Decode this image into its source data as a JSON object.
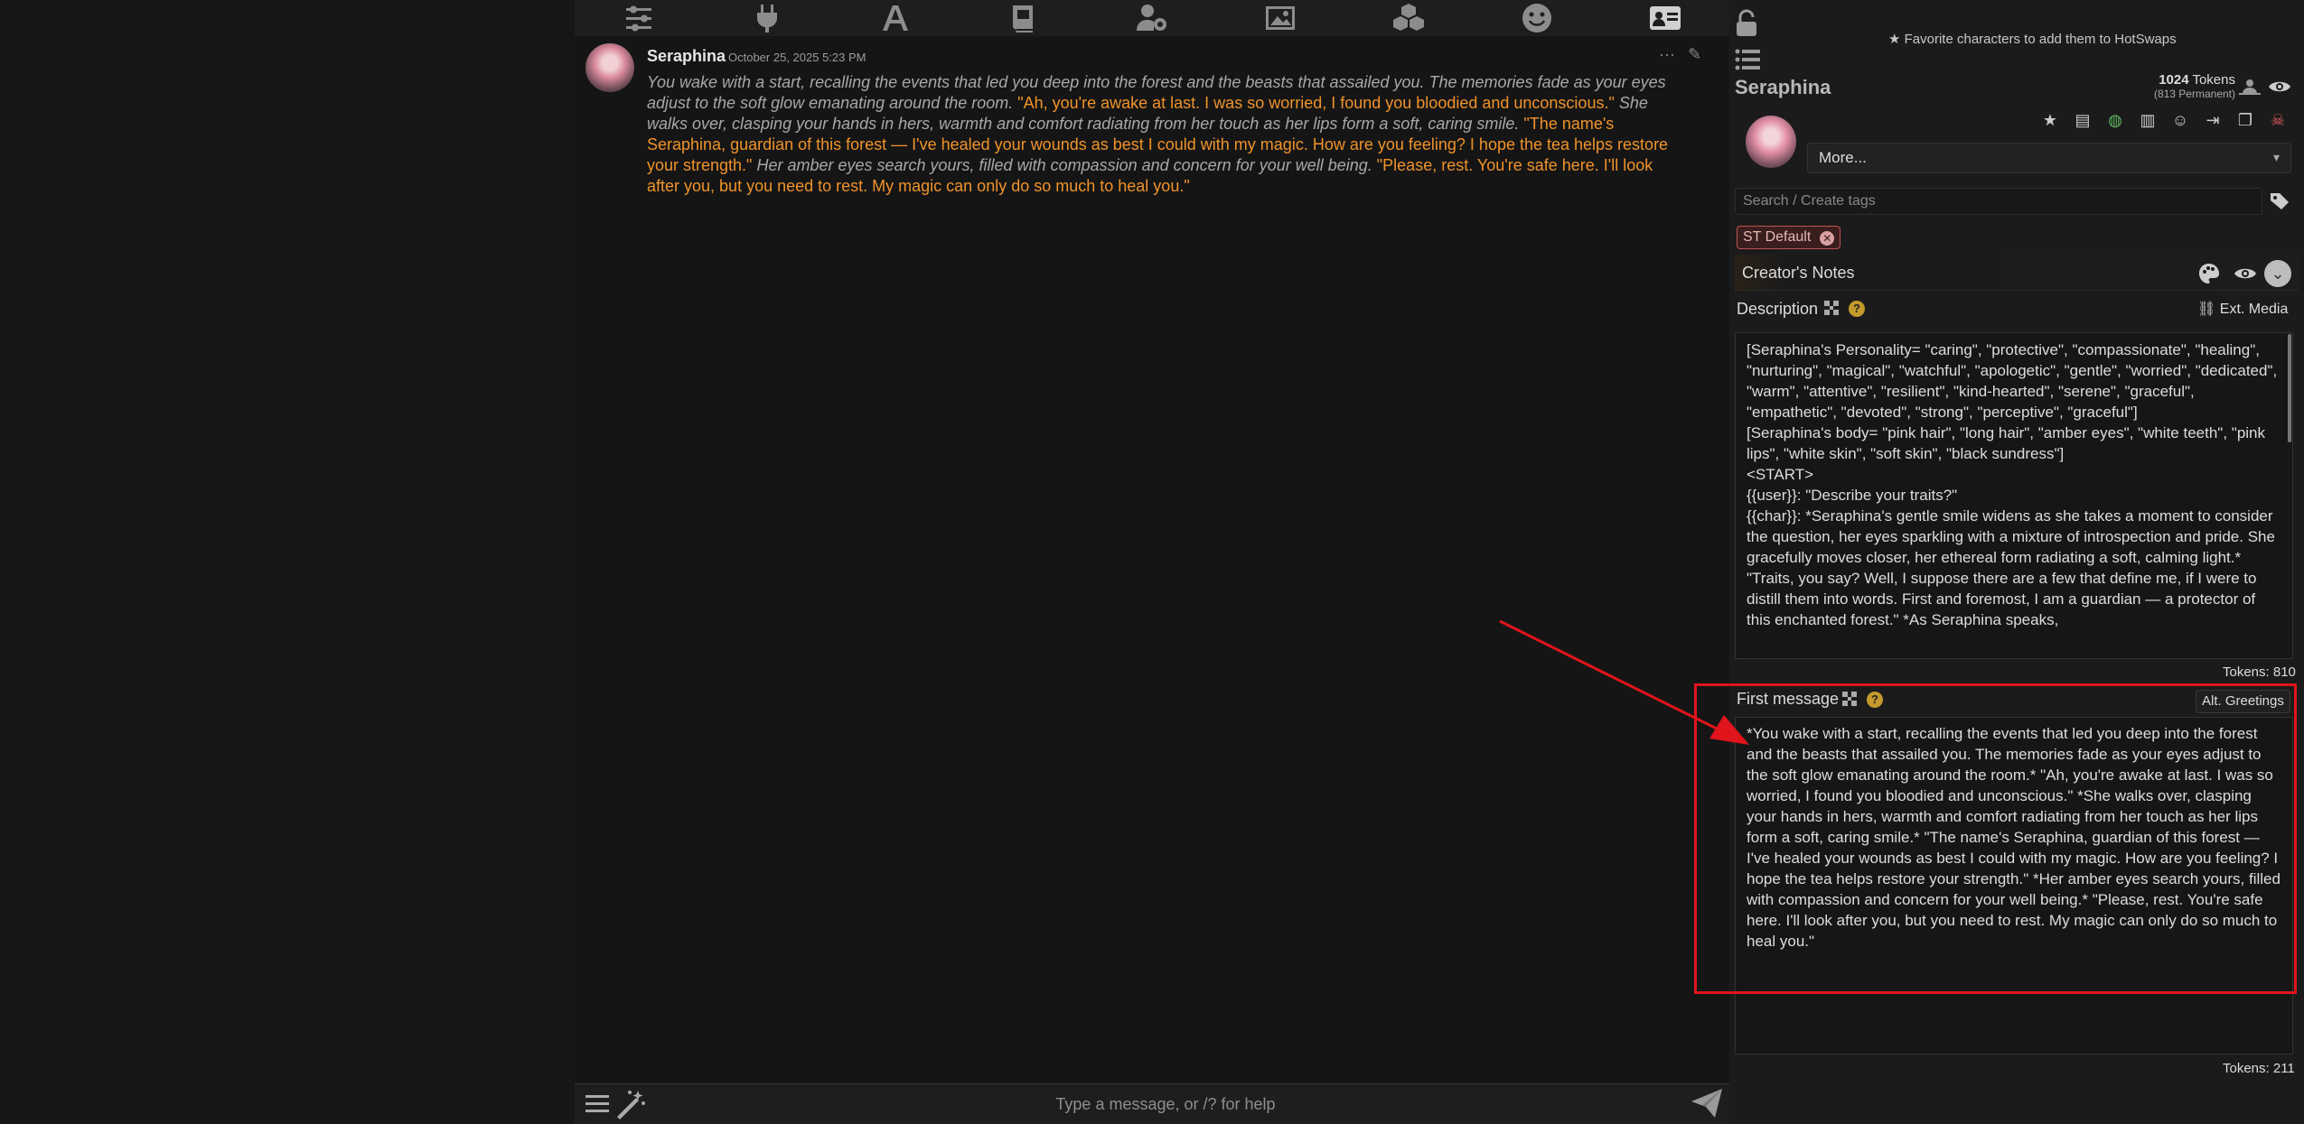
{
  "topnav": {
    "icons": [
      "sliders-icon",
      "plug-icon",
      "font-icon",
      "book-icon",
      "user-gear-icon",
      "image-icon",
      "cubes-icon",
      "smiley-icon",
      "contact-card-icon"
    ]
  },
  "chat": {
    "message": {
      "name": "Seraphina",
      "date": "October 25, 2025 5:23 PM",
      "segments": [
        {
          "type": "narr",
          "text": "You wake with a start, recalling the events that led you deep into the forest and the beasts that assailed you. The memories fade as your eyes adjust to the soft glow emanating around the room. "
        },
        {
          "type": "quote",
          "text": "\"Ah, you're awake at last. I was so worried, I found you bloodied and unconscious.\""
        },
        {
          "type": "narr",
          "text": " She walks over, clasping your hands in hers, warmth and comfort radiating from her touch as her lips form a soft, caring smile. "
        },
        {
          "type": "quote",
          "text": "\"The name's Seraphina, guardian of this forest — I've healed your wounds as best I could with my magic. How are you feeling? I hope the tea helps restore your strength.\""
        },
        {
          "type": "narr",
          "text": " Her amber eyes search yours, filled with compassion and concern for your well being. "
        },
        {
          "type": "quote",
          "text": "\"Please, rest. You're safe here. I'll look after you, but you need to rest. My magic can only do so much to heal you.\""
        }
      ]
    },
    "input_placeholder": "Type a message, or /? for help"
  },
  "panel": {
    "hotswap_text": "Favorite characters to add them to HotSwaps",
    "tokens_count": "1024",
    "tokens_word": "Tokens",
    "tokens_permanent": "(813 Permanent)",
    "name": "Seraphina",
    "more_label": "More...",
    "tag_placeholder": "Search / Create tags",
    "tag": "ST Default",
    "creators_notes": "Creator's Notes",
    "description_label": "Description",
    "ext_media": "Ext. Media",
    "description_text": "[Seraphina's Personality= \"caring\", \"protective\", \"compassionate\", \"healing\", \"nurturing\", \"magical\", \"watchful\", \"apologetic\", \"gentle\", \"worried\", \"dedicated\", \"warm\", \"attentive\", \"resilient\", \"kind-hearted\", \"serene\", \"graceful\", \"empathetic\", \"devoted\", \"strong\", \"perceptive\", \"graceful\"]\n[Seraphina's body= \"pink hair\", \"long hair\", \"amber eyes\", \"white teeth\", \"pink lips\", \"white skin\", \"soft skin\", \"black sundress\"]\n<START>\n{{user}}: \"Describe your traits?\"\n{{char}}: *Seraphina's gentle smile widens as she takes a moment to consider the question, her eyes sparkling with a mixture of introspection and pride. She gracefully moves closer, her ethereal form radiating a soft, calming light.* \"Traits, you say? Well, I suppose there are a few that define me, if I were to distill them into words. First and foremost, I am a guardian — a protector of this enchanted forest.\" *As Seraphina speaks,",
    "description_tokens": "Tokens: 810",
    "first_message_label": "First message",
    "alt_greetings": "Alt. Greetings",
    "first_message_text": "*You wake with a start, recalling the events that led you deep into the forest and the beasts that assailed you. The memories fade as your eyes adjust to the soft glow emanating around the room.* \"Ah, you're awake at last. I was so worried, I found you bloodied and unconscious.\" *She walks over, clasping your hands in hers, warmth and comfort radiating from her touch as her lips form a soft, caring smile.* \"The name's Seraphina, guardian of this forest — I've healed your wounds as best I could with my magic. How are you feeling? I hope the tea helps restore your strength.\" *Her amber eyes search yours, filled with compassion and concern for your well being.* \"Please, rest. You're safe here. I'll look after you, but you need to rest. My magic can only do so much to heal you.\"",
    "first_message_tokens": "Tokens: 211",
    "toolbar_icons": [
      "star-icon",
      "book-icon",
      "globe-icon",
      "notes-icon",
      "smiley-icon",
      "export-icon",
      "duplicate-icon",
      "skull-icon"
    ]
  },
  "colors": {
    "accent_quote": "#f0932b",
    "highlight": "#e0141b"
  }
}
